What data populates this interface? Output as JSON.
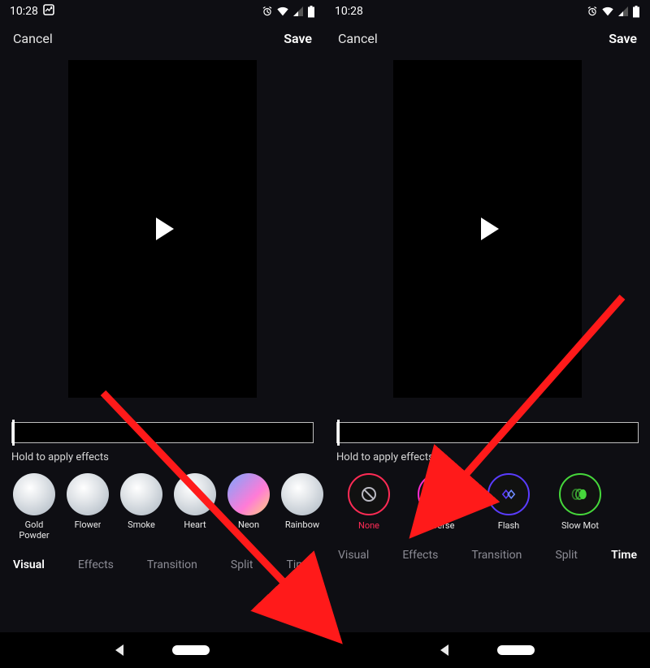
{
  "left": {
    "status": {
      "time": "10:28"
    },
    "header": {
      "cancel": "Cancel",
      "save": "Save"
    },
    "hint_text": "Hold to apply effects",
    "effects": [
      {
        "label": "Gold Powder"
      },
      {
        "label": "Flower"
      },
      {
        "label": "Smoke"
      },
      {
        "label": "Heart"
      },
      {
        "label": "Neon"
      },
      {
        "label": "Rainbow"
      }
    ],
    "tabs": [
      {
        "label": "Visual",
        "active": true
      },
      {
        "label": "Effects",
        "active": false
      },
      {
        "label": "Transition",
        "active": false
      },
      {
        "label": "Split",
        "active": false
      },
      {
        "label": "Time",
        "active": false
      }
    ]
  },
  "right": {
    "status": {
      "time": "10:28"
    },
    "header": {
      "cancel": "Cancel",
      "save": "Save"
    },
    "hint_text": "Hold to apply effects",
    "effects": [
      {
        "label": "None",
        "color": "#ff2b55",
        "icon": "no-entry-icon"
      },
      {
        "label": "Reverse",
        "color": "#ff2bd1",
        "icon": "hourglass-icon"
      },
      {
        "label": "Flash",
        "color": "#5a3cff",
        "icon": "diamond-icon"
      },
      {
        "label": "Slow Mot",
        "color": "#46d83b",
        "icon": "slow-motion-icon"
      }
    ],
    "tabs": [
      {
        "label": "Visual",
        "active": false
      },
      {
        "label": "Effects",
        "active": false
      },
      {
        "label": "Transition",
        "active": false
      },
      {
        "label": "Split",
        "active": false
      },
      {
        "label": "Time",
        "active": true
      }
    ]
  }
}
